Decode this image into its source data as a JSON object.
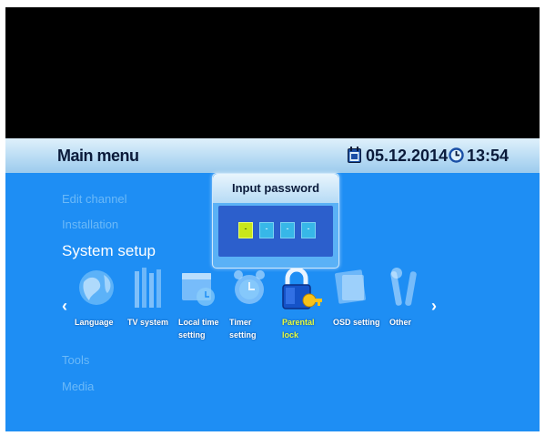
{
  "header": {
    "title": "Main menu",
    "date": "05.12.2014",
    "time": "13:54"
  },
  "menu": {
    "items": [
      {
        "label": "Edit channel",
        "active": false
      },
      {
        "label": "Installation",
        "active": false
      },
      {
        "label": "System setup",
        "active": true
      },
      {
        "label": "Tools",
        "active": false
      },
      {
        "label": "Media",
        "active": false
      }
    ]
  },
  "submenu": {
    "items": [
      {
        "label": "Language",
        "icon": "globe-icon",
        "active": false
      },
      {
        "label": "TV system",
        "icon": "tv-system-icon",
        "active": false
      },
      {
        "label": "Local time\nsetting",
        "icon": "local-time-icon",
        "active": false
      },
      {
        "label": "Timer\nsetting",
        "icon": "alarm-clock-icon",
        "active": false
      },
      {
        "label": "Parental\nlock",
        "icon": "padlock-icon",
        "active": true
      },
      {
        "label": "OSD setting",
        "icon": "osd-setting-icon",
        "active": false
      },
      {
        "label": "Other",
        "icon": "tools-icon",
        "active": false
      }
    ],
    "left_arrow": "‹",
    "right_arrow": "›"
  },
  "dialog": {
    "title": "Input password",
    "digits": [
      "-",
      "-",
      "-",
      "-"
    ],
    "active_index": 0
  },
  "colors": {
    "background": "#1e8ef4",
    "header": "#b9dcf4",
    "active_label": "#e8ff40",
    "inactive_menu": "#6bb9f8"
  }
}
